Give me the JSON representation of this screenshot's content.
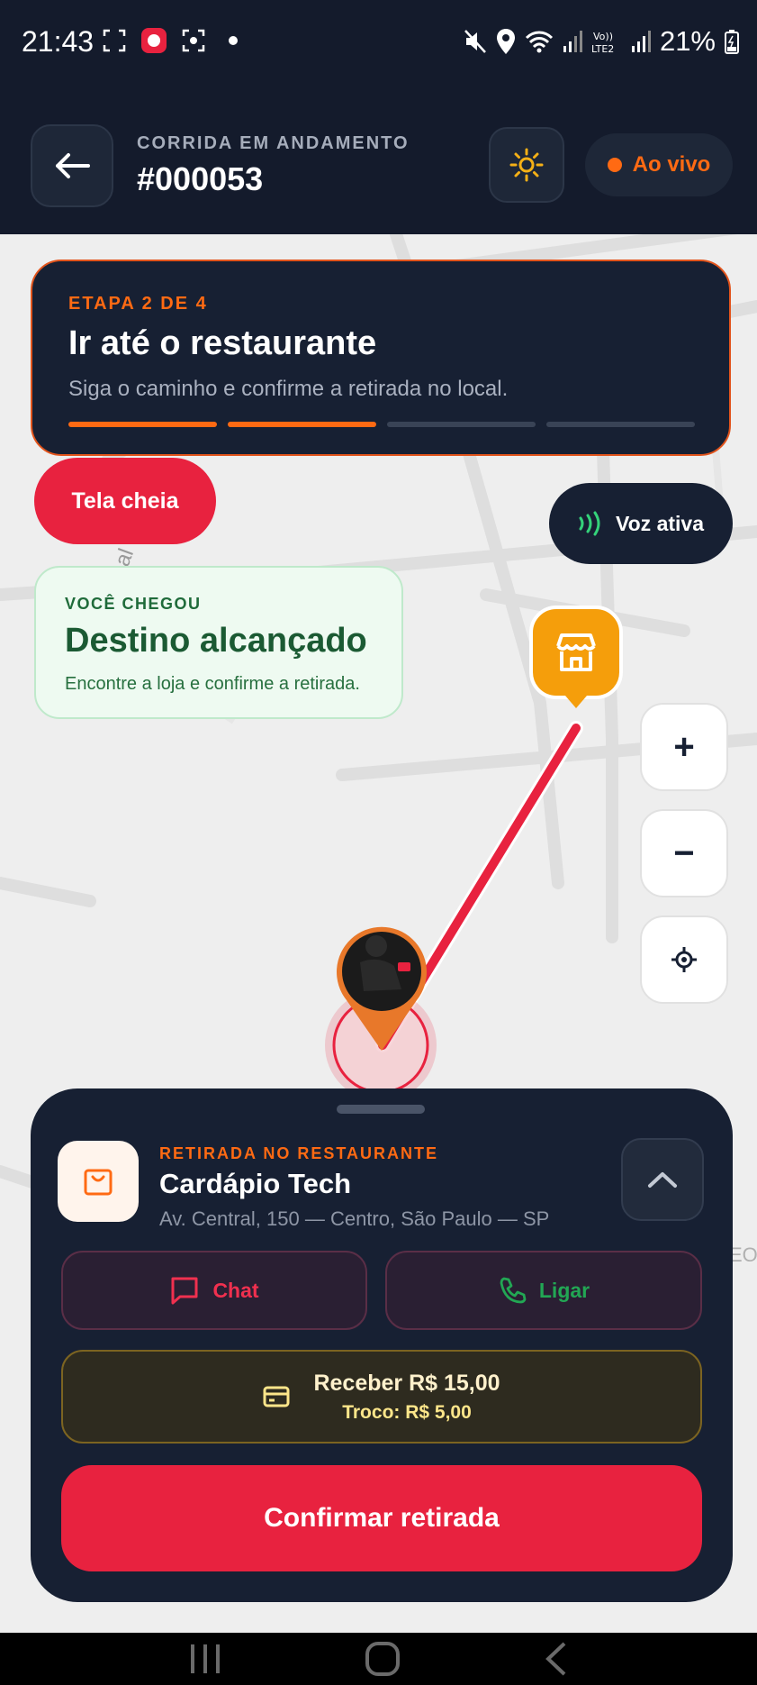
{
  "status_bar": {
    "time": "21:43",
    "battery": "21%"
  },
  "header": {
    "subtitle": "CORRIDA EM ANDAMENTO",
    "title": "#000053",
    "live_label": "Ao vivo"
  },
  "step_card": {
    "label": "ETAPA 2 DE 4",
    "title": "Ir até o restaurante",
    "description": "Siga o caminho e confirme a retirada no local.",
    "current_step": 2,
    "total_steps": 4
  },
  "fullscreen_button": "Tela cheia",
  "voice": {
    "label": "Voz ativa",
    "icon": "sound-waves-icon"
  },
  "arrival_card": {
    "label": "VOCÊ CHEGOU",
    "title": "Destino alcançado",
    "description": "Encontre a loja e confirme a retirada."
  },
  "map_controls": {
    "zoom_in": "+",
    "zoom_out": "−"
  },
  "map_labels": {
    "street_fragment": "al",
    "edge_fragment": "EO"
  },
  "sheet": {
    "label": "RETIRADA NO RESTAURANTE",
    "title": "Cardápio Tech",
    "address": "Av. Central, 150 — Centro, São Paulo — SP",
    "chat_label": "Chat",
    "call_label": "Ligar",
    "payment": {
      "main": "Receber R$ 15,00",
      "change": "Troco: R$ 5,00"
    },
    "confirm_label": "Confirmar retirada"
  },
  "colors": {
    "accent": "#ff6a13",
    "primary_red": "#e8223f",
    "dark": "#172033",
    "store_pin": "#f59e0b",
    "success_green": "#1b5a33"
  }
}
